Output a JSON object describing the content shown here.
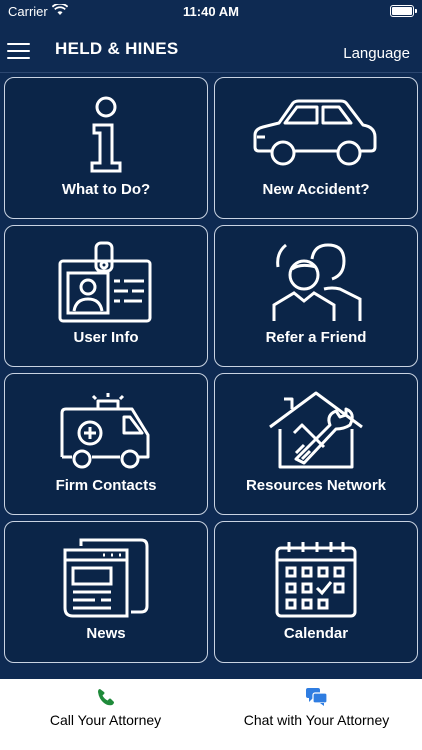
{
  "status_bar": {
    "carrier": "Carrier",
    "time": "11:40 AM"
  },
  "header": {
    "title": "HELD & HINES",
    "language_label": "Language"
  },
  "tiles": [
    {
      "label": "What to Do?",
      "icon": "info-icon"
    },
    {
      "label": "New Accident?",
      "icon": "car-icon"
    },
    {
      "label": "User Info",
      "icon": "id-badge-icon"
    },
    {
      "label": "Refer a Friend",
      "icon": "people-icon"
    },
    {
      "label": "Firm Contacts",
      "icon": "ambulance-icon"
    },
    {
      "label": "Resources Network",
      "icon": "house-tools-icon"
    },
    {
      "label": "News",
      "icon": "newspaper-icon"
    },
    {
      "label": "Calendar",
      "icon": "calendar-icon"
    }
  ],
  "bottom_bar": {
    "call_label": "Call Your Attorney",
    "chat_label": "Chat with Your Attorney"
  },
  "colors": {
    "background": "#0e2a52",
    "tile_border": "#c9d3e2",
    "call_icon": "#1f8a3a",
    "chat_icon": "#2f7de1"
  }
}
